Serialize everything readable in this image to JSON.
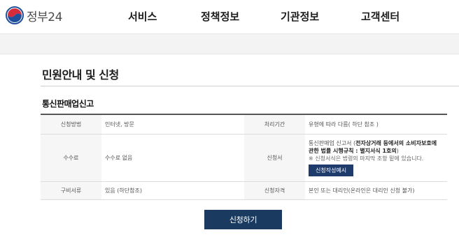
{
  "header": {
    "logo_text": "정부24",
    "nav": [
      "서비스",
      "정책정보",
      "기관정보",
      "고객센터"
    ]
  },
  "page": {
    "title": "민원안내 및 신청",
    "section": "통신판매업신고"
  },
  "table": {
    "row1": {
      "label_a": "신청방법",
      "value_a": "인터넷, 방문",
      "label_b": "처리기간",
      "value_b": "유형에 따라 다름( 하단 참조 )"
    },
    "row2": {
      "label_a": "수수료",
      "value_a": "수수료 없음",
      "label_b": "신청서",
      "value_b_prefix": "통신판매업 신고서 (",
      "value_b_bold": "전자상거래 등에서의 소비자보호에 관한 법률 시행규칙 : 별지서식 1호의",
      "value_b_suffix": ")",
      "note": "※ 신청서식은 법령의 마지막 조항 밑에 있습니다.",
      "sample_button": "신청작성예시"
    },
    "row3": {
      "label_a": "구비서류",
      "value_a": "있음 (하단참조)",
      "label_b": "신청자격",
      "value_b": "본인 또는 대리인(온라인은 대리인 신청 불가)"
    }
  },
  "apply_button": "신청하기",
  "colors": {
    "nav_dark": "#1d1d1d",
    "button_navy": "#1b3a5f",
    "sample_button": "#1f3b6b",
    "logo_red": "#d52b3a",
    "logo_blue": "#1f4e9c"
  }
}
